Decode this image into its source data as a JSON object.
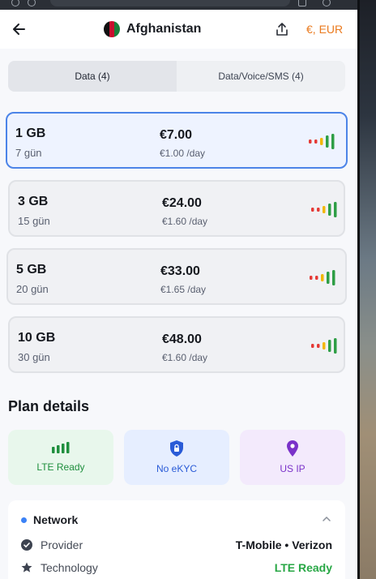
{
  "header": {
    "country": "Afghanistan",
    "currency": "€, EUR"
  },
  "tabs": [
    {
      "label": "Data (4)",
      "active": true
    },
    {
      "label": "Data/Voice/SMS (4)",
      "active": false
    }
  ],
  "plans": [
    {
      "size": "1 GB",
      "days": "7 gün",
      "price": "€7.00",
      "per_day": "€1.00 /day",
      "selected": true
    },
    {
      "size": "3 GB",
      "days": "15 gün",
      "price": "€24.00",
      "per_day": "€1.60 /day",
      "selected": false
    },
    {
      "size": "5 GB",
      "days": "20 gün",
      "price": "€33.00",
      "per_day": "€1.65 /day",
      "selected": false
    },
    {
      "size": "10 GB",
      "days": "30 gün",
      "price": "€48.00",
      "per_day": "€1.60 /day",
      "selected": false
    }
  ],
  "plan_details": {
    "title": "Plan details",
    "features": [
      {
        "label": "LTE Ready",
        "icon": "signal-bars-icon"
      },
      {
        "label": "No eKYC",
        "icon": "shield-lock-icon"
      },
      {
        "label": "US IP",
        "icon": "location-pin-icon"
      }
    ]
  },
  "network": {
    "title": "Network",
    "rows": [
      {
        "label": "Provider",
        "value": "T-Mobile • Verizon",
        "icon": "check-circle-icon"
      },
      {
        "label": "Technology",
        "value": "LTE Ready",
        "icon": "star-icon"
      }
    ]
  },
  "colors": {
    "accent_orange": "#ea7a1e",
    "selected_border": "#4c84e8",
    "signal_red": "#e53935",
    "signal_yellow": "#f2b705",
    "signal_green": "#2e9e45"
  }
}
